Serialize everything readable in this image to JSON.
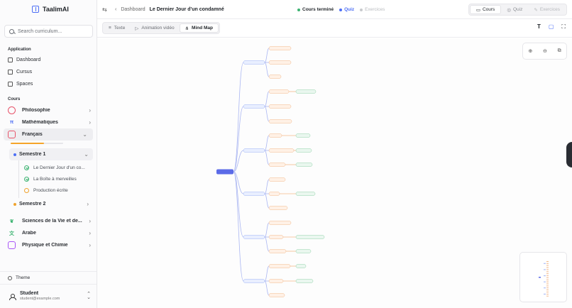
{
  "app": {
    "title": "TaalimAI"
  },
  "search": {
    "placeholder": "Search curriculum..."
  },
  "sidebar": {
    "application_title": "Application",
    "nav": [
      {
        "label": "Dashboard",
        "icon": "grid-icon"
      },
      {
        "label": "Cursus",
        "icon": "home-icon"
      },
      {
        "label": "Spaces",
        "icon": "chat-icon"
      }
    ],
    "cours_title": "Cours",
    "courses": [
      {
        "label": "Philosophie",
        "icon": "brain-icon",
        "color": "#e8546a"
      },
      {
        "label": "Mathématiques",
        "icon": "pi-icon",
        "color": "#4c6ef5"
      },
      {
        "label": "Français",
        "icon": "book-icon",
        "color": "#e8546a"
      },
      {
        "label": "Sciences de la Vie et de...",
        "icon": "leaf-icon",
        "color": "#3cb371"
      },
      {
        "label": "Arabe",
        "icon": "translate-icon",
        "color": "#3cb371"
      },
      {
        "label": "Physique et Chimie",
        "icon": "atom-icon",
        "color": "#a855f7"
      }
    ],
    "french_progress": 0.64,
    "semesters": [
      {
        "label": "Semestre 1",
        "color": "#4c6ef5"
      },
      {
        "label": "Semestre 2",
        "color": "#f0a32e"
      }
    ],
    "lessons": [
      {
        "label": "Le Dernier Jour d'un co...",
        "status": "done"
      },
      {
        "label": "La Boîte à merveilles",
        "status": "done"
      },
      {
        "label": "Production écrite",
        "status": "pending"
      }
    ],
    "theme_label": "Theme",
    "user": {
      "name": "Student",
      "email": "student@example.com"
    }
  },
  "topbar": {
    "breadcrumb_root": "Dashboard",
    "breadcrumb_current": "Le Dernier Jour d'un condamné",
    "status": [
      {
        "label": "Cours terminé",
        "color": "#3cb371"
      },
      {
        "label": "Quiz",
        "color": "#4c6ef5"
      },
      {
        "label": "Exercices",
        "color": "#c8cacd"
      }
    ],
    "segments": [
      {
        "label": "Cours",
        "state": "on"
      },
      {
        "label": "Quiz",
        "state": "normal"
      },
      {
        "label": "Exercices",
        "state": "disabled"
      }
    ]
  },
  "toolbar": {
    "tabs": [
      {
        "label": "Texte",
        "icon": "text-lines-icon"
      },
      {
        "label": "Animation vidéo",
        "icon": "play-icon"
      },
      {
        "label": "Mind Map",
        "icon": "mindmap-icon"
      }
    ],
    "active_tab": "Mind Map"
  }
}
